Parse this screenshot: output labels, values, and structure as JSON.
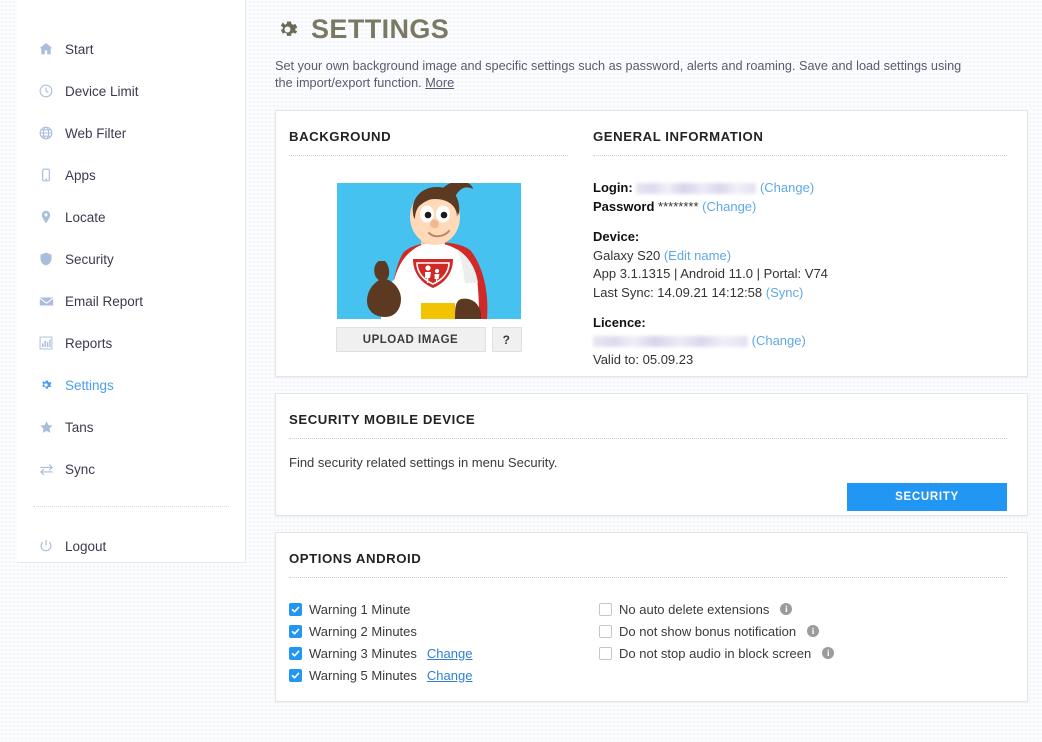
{
  "sidebar": {
    "items": [
      {
        "label": "Start",
        "icon": "home-icon",
        "active": false
      },
      {
        "label": "Device Limit",
        "icon": "clock-icon",
        "active": false
      },
      {
        "label": "Web Filter",
        "icon": "globe-icon",
        "active": false
      },
      {
        "label": "Apps",
        "icon": "mobile-icon",
        "active": false
      },
      {
        "label": "Locate",
        "icon": "map-pin-icon",
        "active": false
      },
      {
        "label": "Security",
        "icon": "shield-icon",
        "active": false
      },
      {
        "label": "Email Report",
        "icon": "envelope-icon",
        "active": false
      },
      {
        "label": "Reports",
        "icon": "bar-chart-icon",
        "active": false
      },
      {
        "label": "Settings",
        "icon": "gear-icon",
        "active": true
      },
      {
        "label": "Tans",
        "icon": "star-icon",
        "active": false
      },
      {
        "label": "Sync",
        "icon": "sync-icon",
        "active": false
      }
    ],
    "logout": {
      "label": "Logout",
      "icon": "power-icon"
    }
  },
  "header": {
    "title": "SETTINGS",
    "gear_icon": "gear-icon",
    "subtitle": "Set your own background image and specific settings such as password, alerts and roaming. Save and load settings using the import/export function.",
    "more_link": "More"
  },
  "background_panel": {
    "section_title": "BACKGROUND",
    "image_alt": "superhero-mascot-thumbs-up",
    "upload_label": "UPLOAD IMAGE",
    "help_label": "?"
  },
  "general_panel": {
    "section_title": "GENERAL INFORMATION",
    "login_label": "Login:",
    "login_value": "",
    "login_change": "(Change)",
    "password_label": "Password",
    "password_value": "********",
    "password_change": "(Change)",
    "device_label": "Device:",
    "device_name": "Galaxy S20",
    "device_edit": "(Edit name)",
    "device_versions": "App 3.1.1315 | Android 11.0 | Portal: V74",
    "last_sync": "Last Sync: 14.09.21 14:12:58",
    "sync_link": "(Sync)",
    "licence_label": "Licence:",
    "licence_value": "",
    "licence_change": "(Change)",
    "licence_valid": "Valid to: 05.09.23"
  },
  "security_panel": {
    "section_title": "SECURITY MOBILE DEVICE",
    "body_text": "Find security related settings in menu Security.",
    "button_label": "SECURITY"
  },
  "options_panel": {
    "section_title": "OPTIONS ANDROID",
    "left_options": [
      {
        "label": "Warning 1 Minute",
        "checked": true,
        "change": ""
      },
      {
        "label": "Warning 2 Minutes",
        "checked": true,
        "change": ""
      },
      {
        "label": "Warning 3 Minutes",
        "checked": true,
        "change": "Change"
      },
      {
        "label": "Warning 5 Minutes",
        "checked": true,
        "change": "Change"
      }
    ],
    "right_options": [
      {
        "label": "No auto delete extensions",
        "checked": false,
        "info": "i"
      },
      {
        "label": "Do not show bonus notification",
        "checked": false,
        "info": "i"
      },
      {
        "label": "Do not stop audio in block screen",
        "checked": false,
        "info": "i"
      }
    ]
  },
  "colors": {
    "accent_blue": "#2196f3",
    "link_blue": "#5fa8e8",
    "sidebar_icon": "#a9bedb",
    "title_olive": "#7a7a64",
    "mascot_sky": "#45c2f0",
    "mascot_cape": "#d32f2f",
    "mascot_belt": "#f2c300"
  }
}
